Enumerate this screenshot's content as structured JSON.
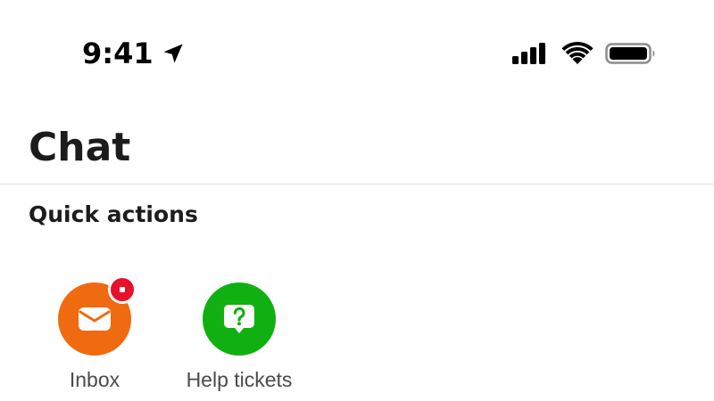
{
  "status_bar": {
    "time": "9:41",
    "icons": {
      "location": "location-arrow-icon",
      "signal": "cellular-signal-icon",
      "wifi": "wifi-icon",
      "battery": "battery-icon"
    }
  },
  "header": {
    "title": "Chat"
  },
  "quick_actions": {
    "title": "Quick actions",
    "items": [
      {
        "label": "Inbox",
        "icon": "envelope-icon",
        "color": "#f06a0f",
        "has_notification": true,
        "notification_color": "#e8102a"
      },
      {
        "label": "Help tickets",
        "icon": "question-bubble-icon",
        "color": "#11b011",
        "has_notification": false
      }
    ]
  }
}
